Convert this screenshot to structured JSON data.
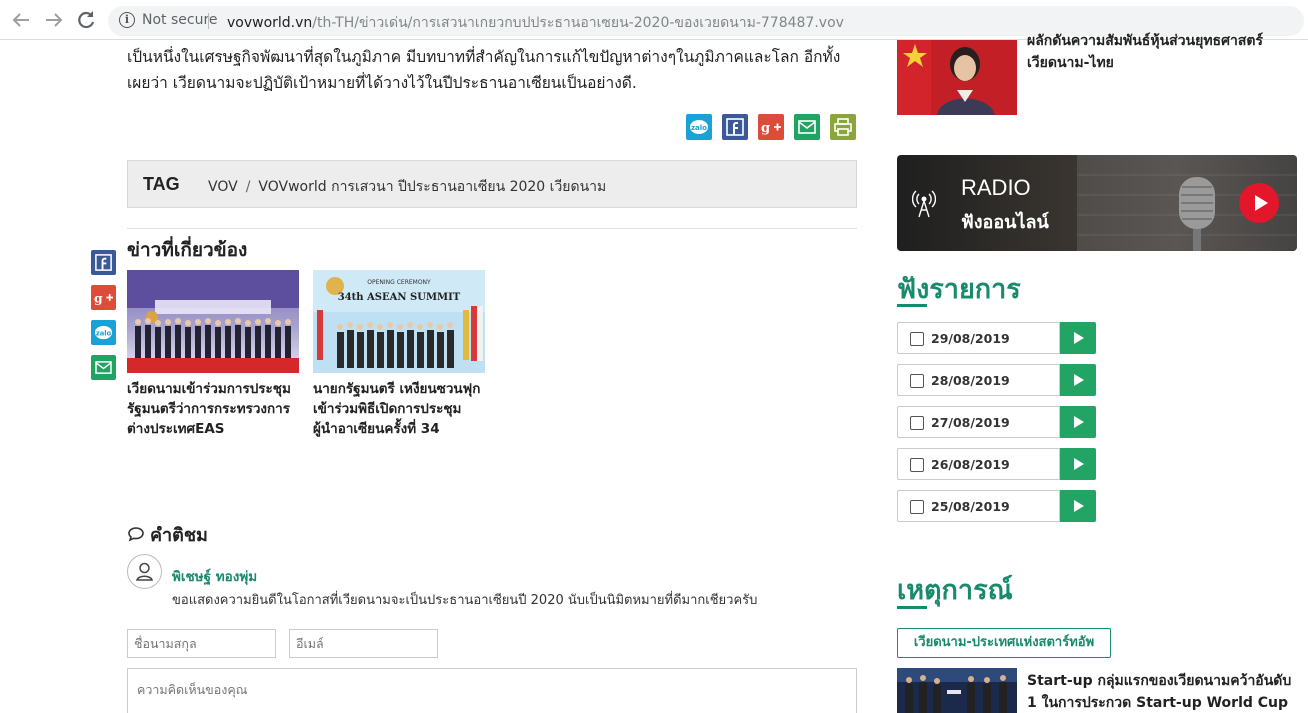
{
  "browser": {
    "back_icon": "back-arrow-icon",
    "forward_icon": "forward-arrow-icon",
    "reload_icon": "reload-icon",
    "security": "Not secure",
    "url_host": "vovworld.vn",
    "url_path": "/th-TH/ข่าวเด่น/การเสวนาเกยวกบปประธานอาเซยน-2020-ของเวยดนาม-778487.vov"
  },
  "article": {
    "text": "เป็นหนึ่งในเศรษฐกิจพัฒนาที่สุดในภูมิภาค มีบทบาทที่สำคัญในการแก้ไขปัญหาต่างๆในภูมิภาคและโลก อีกทั้ง เผยว่า เวียดนามจะปฏิบัติเป้าหมายที่ได้วางไว้ในปีประธานอาเซียนเป็นอย่างดี."
  },
  "share_icons": {
    "zalo": "zalo",
    "facebook": "f",
    "google_plus": "g+",
    "colors": {
      "zalo": "#1aa1d6",
      "facebook": "#3b5998",
      "google_plus": "#dd4b39",
      "email": "#1fa463",
      "print": "#8aa63a"
    }
  },
  "tags": {
    "label": "TAG",
    "items": [
      "VOV",
      "VOVworld การเสวนา ปีประธานอาเซียน 2020 เวียดนาม"
    ],
    "separator": "/"
  },
  "related": {
    "title": "ข่าวที่เกี่ยวข้อง",
    "items": [
      {
        "caption": "เวียดนามเข้าร่วมการประชุมรัฐมนตรีว่าการกระทรวงการต่างประเทศEAS"
      },
      {
        "caption": "นายกรัฐมนตรี เหงียนซวนฟุก เข้าร่วมพิธีเปิดการประชุมผู้นำอาเซียนครั้งที่ 34",
        "image_text": {
          "line1": "OPENING CEREMONY",
          "line2": "34th ASEAN SUMMIT"
        }
      }
    ]
  },
  "comments": {
    "title": "คำติชม",
    "items": [
      {
        "author": "พิเชษฐ์ ทองพุ่ม",
        "text": "ขอแสดงความยินดีในโอกาสที่เวียดนามจะเป็นประธานอาเซียนปี 2020 นับเป็นนิมิตหมายที่ดีมากเชียวครับ"
      }
    ],
    "form": {
      "name_placeholder": "ชื่อนามสกุล",
      "email_placeholder": "อีเมล์",
      "comment_placeholder": "ความคิดเห็นของคุณ"
    }
  },
  "sidebar": {
    "top_news": "ผลักดันความสัมพันธ์หุ้นส่วนยุทธศาสตร์ เวียดนาม-ไทย",
    "radio": {
      "title": "RADIO",
      "subtitle": "ฟังออนไลน์"
    },
    "programs": {
      "title": "ฟังรายการ",
      "dates": [
        "29/08/2019",
        "28/08/2019",
        "27/08/2019",
        "26/08/2019",
        "25/08/2019"
      ]
    },
    "events": {
      "title": "เหตุการณ์",
      "button": "เวียดนาม-ประเทศแห่งสตาร์ทอัพ",
      "item_text": "Start-up กลุ่มแรกของเวียดนามคว้าอันดับ 1 ในการประกวด Start-up World Cup"
    }
  }
}
